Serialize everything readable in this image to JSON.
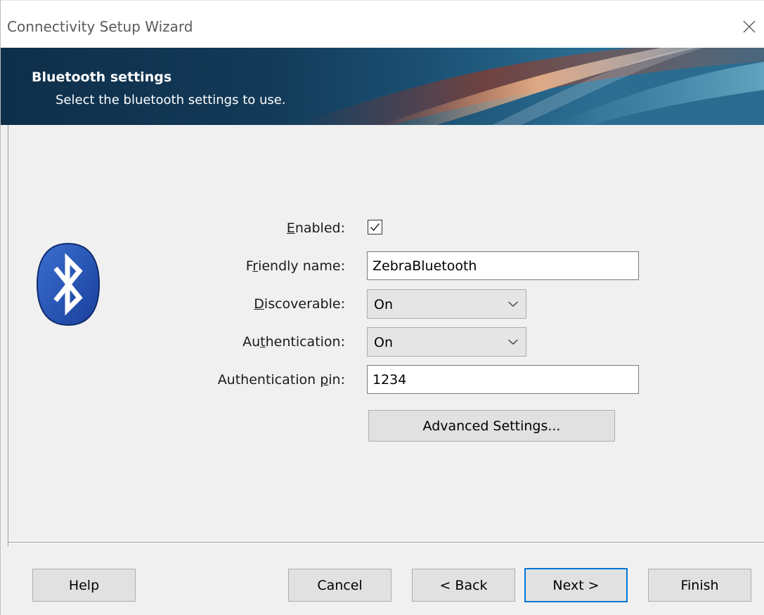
{
  "window": {
    "title": "Connectivity Setup Wizard"
  },
  "banner": {
    "title": "Bluetooth settings",
    "subtitle": "Select the bluetooth settings to use."
  },
  "form": {
    "enabled": {
      "label_pre": "",
      "label_acc": "E",
      "label_post": "nabled:",
      "checked": true
    },
    "friendly_name": {
      "label_pre": "F",
      "label_acc": "r",
      "label_post": "iendly name:",
      "value": "ZebraBluetooth"
    },
    "discoverable": {
      "label_pre": "",
      "label_acc": "D",
      "label_post": "iscoverable:",
      "value": "On"
    },
    "authentication": {
      "label_pre": "Au",
      "label_acc": "t",
      "label_post": "hentication:",
      "value": "On"
    },
    "authentication_pin": {
      "label_pre": "Authentication ",
      "label_acc": "p",
      "label_post": "in:",
      "value": "1234"
    },
    "advanced_label": "Advanced Settings..."
  },
  "footer": {
    "help_label": "Help",
    "cancel_label": "Cancel",
    "back_label": "< Back",
    "next_label": "Next >",
    "finish_label": "Finish"
  },
  "icons": {
    "close": "close-icon",
    "bluetooth": "bluetooth-icon",
    "check": "checkmark-icon",
    "chevron": "chevron-down-icon"
  },
  "colors": {
    "banner_dark": "#0e2f4a",
    "banner_accent": "#2b6e92",
    "focus_border": "#0078d7",
    "bluetooth_blue": "#1d4fb0"
  }
}
